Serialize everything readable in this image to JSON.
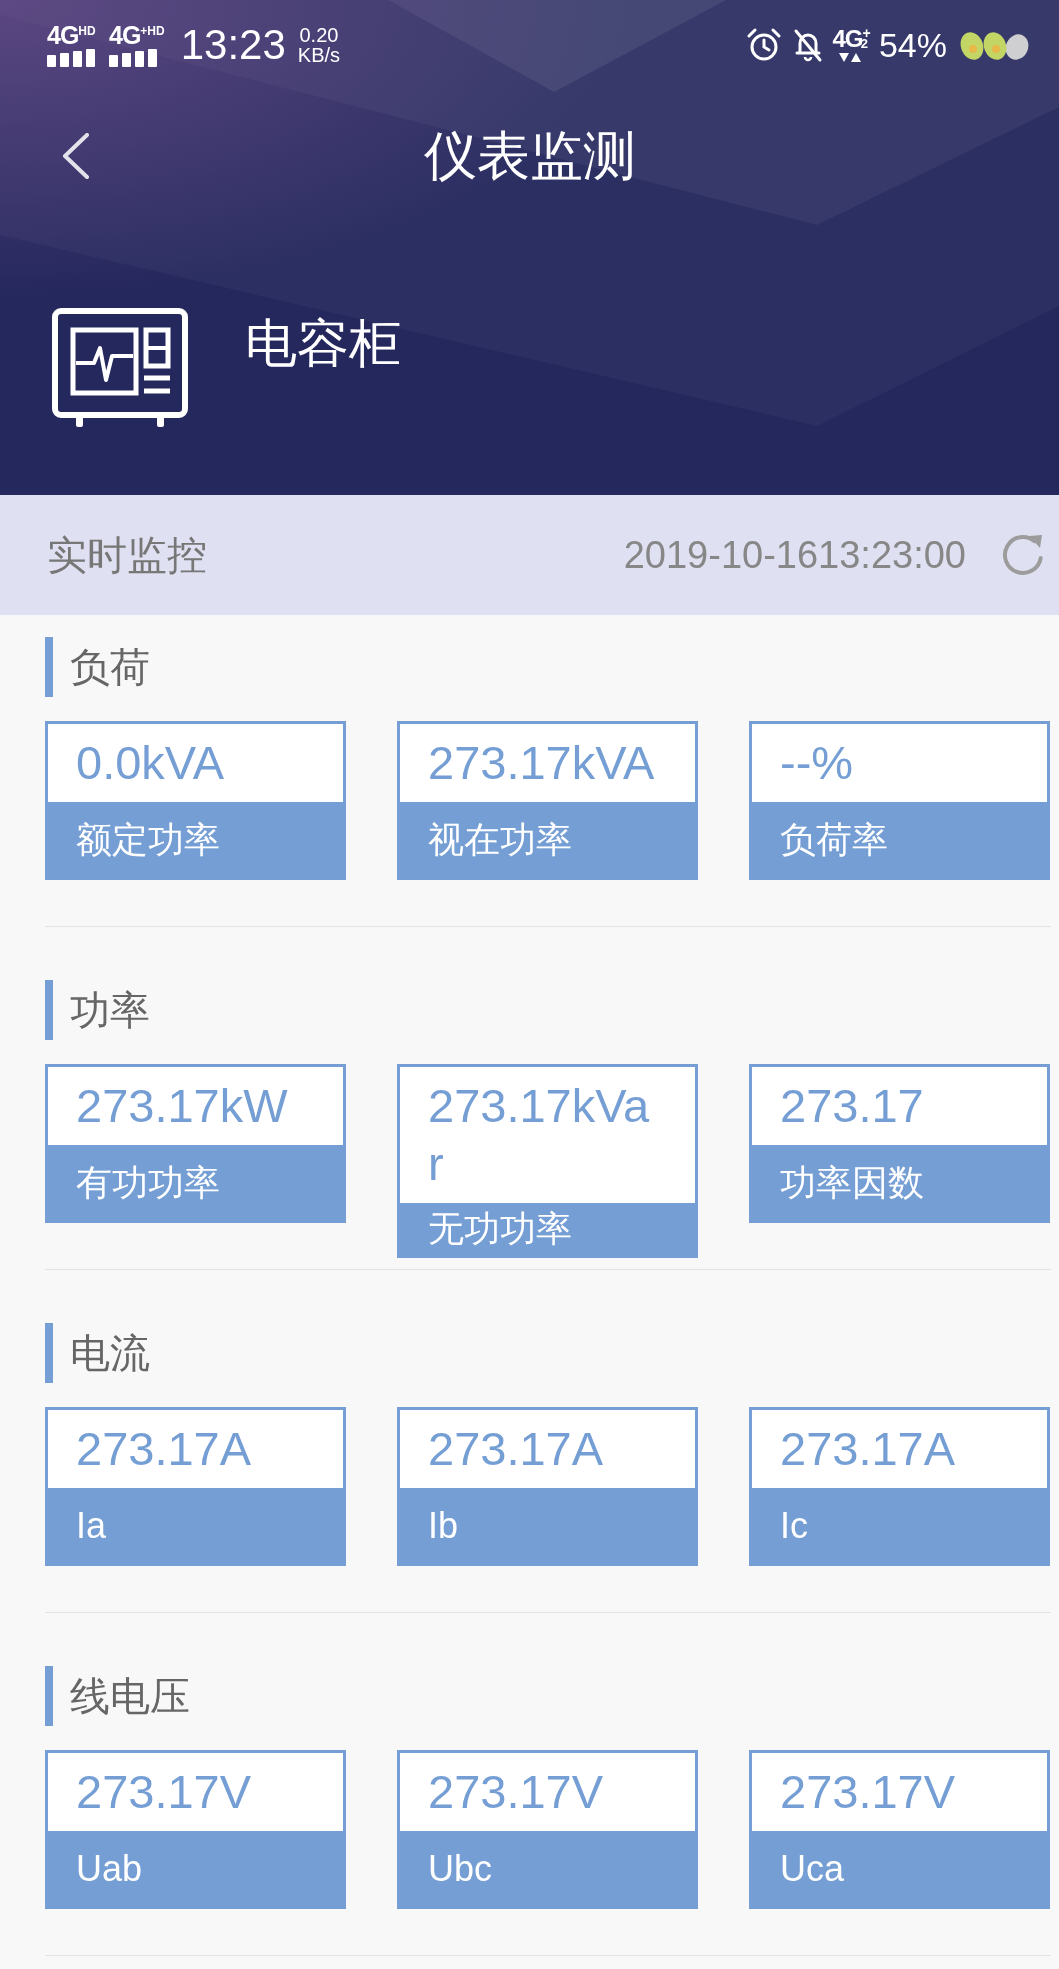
{
  "status_bar": {
    "signals": [
      {
        "label": "4G$^{HD}$"
      },
      {
        "label": "4G$^{+HD}$"
      }
    ],
    "time": "13:23",
    "speed": {
      "value": "0.20",
      "unit": "KB/s"
    },
    "network": "4G$^{+}$$_{2}$",
    "battery": "54%"
  },
  "nav_bar": {
    "title": "仪表监测"
  },
  "device": {
    "name": "电容柜"
  },
  "realtime_bar": {
    "label": "实时监控",
    "timestamp": "2019-10-1613:23:00"
  },
  "sections": [
    {
      "title": "负荷",
      "cards": [
        {
          "value": "0.0kVA",
          "label": "额定功率"
        },
        {
          "value": "273.17kVA",
          "label": "视在功率"
        },
        {
          "value": "--%",
          "label": "负荷率"
        }
      ]
    },
    {
      "title": "功率",
      "cards": [
        {
          "value": "273.17kW",
          "label": "有功功率"
        },
        {
          "value": "273.17kVar",
          "label": "无功功率"
        },
        {
          "value": "273.17",
          "label": "功率因数"
        }
      ]
    },
    {
      "title": "电流",
      "cards": [
        {
          "value": "273.17A",
          "label": "Ia"
        },
        {
          "value": "273.17A",
          "label": "Ib"
        },
        {
          "value": "273.17A",
          "label": "Ic"
        }
      ]
    },
    {
      "title": "线电压",
      "cards": [
        {
          "value": "273.17V",
          "label": "Uab"
        },
        {
          "value": "273.17V",
          "label": "Ubc"
        },
        {
          "value": "273.17V",
          "label": "Uca"
        }
      ]
    }
  ]
}
